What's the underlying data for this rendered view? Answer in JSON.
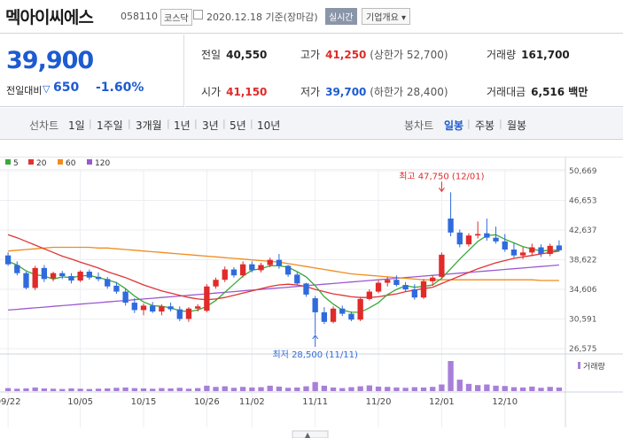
{
  "header": {
    "name": "멕아이씨에스",
    "code": "058110",
    "market": "코스닥",
    "date_text": "2020.12.18 기준(장마감)",
    "realtime_label": "실시간",
    "info_label": "기업개요 ▾"
  },
  "quote": {
    "price": "39,900",
    "change_label": "전일대비",
    "change": "650",
    "change_pct": "-1.60%"
  },
  "stats": {
    "prev_close_label": "전일",
    "prev_close": "40,550",
    "high_label": "고가",
    "high": "41,250",
    "upper_limit": "(상한가 52,700)",
    "volume_label": "거래량",
    "volume": "161,700",
    "open_label": "시가",
    "open": "41,150",
    "low_label": "저가",
    "low": "39,700",
    "lower_limit": "(하한가 28,400)",
    "amount_label": "거래대금",
    "amount": "6,516 백만"
  },
  "tabs": {
    "line_chart": "선차트",
    "t1d": "1일",
    "t1w": "1주일",
    "t3m": "3개월",
    "t1y": "1년",
    "t3y": "3년",
    "t5y": "5년",
    "t10y": "10년",
    "candle_chart": "봉차트",
    "daily": "일봉",
    "weekly": "주봉",
    "monthly": "월봉"
  },
  "colors": {
    "up": "#e12a2a",
    "down": "#2f6bdc",
    "ma5": "#3aa83a",
    "ma20": "#e03434",
    "ma60": "#f08c1e",
    "ma120": "#9b59d0",
    "volume": "#a87fd8"
  },
  "chart_data": {
    "type": "candlestick",
    "legend": [
      {
        "name": "5",
        "color": "#3aa83a"
      },
      {
        "name": "20",
        "color": "#e03434"
      },
      {
        "name": "60",
        "color": "#f08c1e"
      },
      {
        "name": "120",
        "color": "#9b59d0"
      }
    ],
    "y_ticks": [
      "50,669",
      "46,653",
      "42,637",
      "38,622",
      "34,606",
      "30,591",
      "26,575"
    ],
    "ylim": [
      26575,
      50669
    ],
    "x_ticks": [
      "09/22",
      "10/05",
      "10/15",
      "10/26",
      "11/02",
      "11/11",
      "11/20",
      "12/01",
      "12/10"
    ],
    "x_tick_index": [
      0,
      8,
      15,
      22,
      27,
      34,
      41,
      48,
      55
    ],
    "volume_label": "거래량",
    "annotations": {
      "high_text": "최고 47,750 (12/01)",
      "high_index": 48,
      "high_value": 47750,
      "low_text": "최저 28,500 (11/11)",
      "low_index": 34,
      "low_value": 28500
    },
    "candles": [
      [
        39200,
        39600,
        37800,
        38000
      ],
      [
        37900,
        38400,
        36500,
        36800
      ],
      [
        36800,
        37000,
        34600,
        34800
      ],
      [
        34800,
        37800,
        34500,
        37500
      ],
      [
        37500,
        37900,
        35600,
        36000
      ],
      [
        36100,
        37000,
        35700,
        36800
      ],
      [
        36800,
        37100,
        36000,
        36400
      ],
      [
        36400,
        36800,
        35400,
        35800
      ],
      [
        35800,
        37200,
        35600,
        37000
      ],
      [
        37000,
        37300,
        35900,
        36200
      ],
      [
        36300,
        36900,
        35700,
        36000
      ],
      [
        36000,
        36300,
        34700,
        35000
      ],
      [
        35100,
        35600,
        34000,
        34300
      ],
      [
        34300,
        34700,
        32400,
        32800
      ],
      [
        32800,
        33400,
        31400,
        31800
      ],
      [
        31800,
        32700,
        31100,
        32400
      ],
      [
        32400,
        32900,
        31400,
        31600
      ],
      [
        31600,
        32600,
        31100,
        32300
      ],
      [
        32300,
        32800,
        31600,
        31900
      ],
      [
        31900,
        32300,
        30300,
        30600
      ],
      [
        30600,
        32200,
        30200,
        32000
      ],
      [
        32000,
        32600,
        31600,
        32300
      ],
      [
        31700,
        35300,
        31500,
        35000
      ],
      [
        35000,
        36200,
        34700,
        35900
      ],
      [
        35900,
        37700,
        35600,
        37300
      ],
      [
        37300,
        37600,
        36200,
        36500
      ],
      [
        36500,
        38400,
        36200,
        38000
      ],
      [
        38000,
        38400,
        36900,
        37200
      ],
      [
        37200,
        38200,
        36900,
        37900
      ],
      [
        37900,
        38900,
        37600,
        38600
      ],
      [
        38600,
        39400,
        37400,
        37800
      ],
      [
        37800,
        37900,
        36300,
        36600
      ],
      [
        36600,
        36900,
        35200,
        35400
      ],
      [
        35400,
        35500,
        33600,
        33900
      ],
      [
        33400,
        33700,
        28500,
        31500
      ],
      [
        31500,
        32200,
        29900,
        30200
      ],
      [
        30200,
        32300,
        30000,
        32000
      ],
      [
        32000,
        32400,
        31000,
        31300
      ],
      [
        31300,
        31600,
        30300,
        30500
      ],
      [
        30500,
        33600,
        30300,
        33300
      ],
      [
        33300,
        34600,
        33100,
        34300
      ],
      [
        34300,
        35800,
        34100,
        35500
      ],
      [
        35500,
        36300,
        35000,
        35900
      ],
      [
        35900,
        36500,
        35000,
        35200
      ],
      [
        35200,
        35600,
        34300,
        34600
      ],
      [
        34600,
        35300,
        33200,
        33500
      ],
      [
        33500,
        36000,
        33300,
        35700
      ],
      [
        35700,
        36500,
        35100,
        36200
      ],
      [
        36300,
        39600,
        36100,
        39300
      ],
      [
        44200,
        47750,
        41800,
        42300
      ],
      [
        42300,
        42700,
        40300,
        40700
      ],
      [
        40700,
        42200,
        40400,
        41900
      ],
      [
        41900,
        43800,
        41500,
        42100
      ],
      [
        42200,
        44200,
        41200,
        41600
      ],
      [
        41600,
        43100,
        40800,
        41100
      ],
      [
        41100,
        42100,
        39700,
        40000
      ],
      [
        40000,
        40900,
        38900,
        39200
      ],
      [
        39200,
        40300,
        38700,
        39600
      ],
      [
        39600,
        40800,
        39100,
        40300
      ],
      [
        40300,
        40700,
        39000,
        39400
      ],
      [
        39400,
        40800,
        39100,
        40500
      ],
      [
        40550,
        41250,
        39700,
        39900
      ]
    ],
    "ma5": [
      38400,
      37900,
      37100,
      36600,
      36400,
      36000,
      36300,
      36200,
      36400,
      36500,
      36200,
      35900,
      35500,
      34700,
      33700,
      32900,
      32400,
      32300,
      32100,
      31700,
      31600,
      31800,
      32300,
      33100,
      34200,
      35300,
      36400,
      37200,
      37400,
      37800,
      37800,
      37600,
      37000,
      36300,
      35100,
      33600,
      32600,
      31800,
      31500,
      31500,
      32100,
      32800,
      33900,
      34600,
      35100,
      34900,
      35000,
      35200,
      36100,
      37400,
      38700,
      39900,
      41100,
      41900,
      42000,
      41400,
      40900,
      40400,
      40100,
      39800,
      39900,
      39900
    ],
    "ma20": [
      42000,
      41600,
      41100,
      40600,
      40100,
      39600,
      39100,
      38700,
      38300,
      37900,
      37500,
      37000,
      36600,
      36200,
      35700,
      35200,
      34800,
      34400,
      34100,
      33800,
      33500,
      33300,
      33200,
      33300,
      33500,
      33800,
      34100,
      34400,
      34700,
      35000,
      35200,
      35300,
      35200,
      35000,
      34600,
      34300,
      34000,
      33800,
      33600,
      33500,
      33500,
      33600,
      33800,
      34000,
      34300,
      34500,
      34700,
      34900,
      35400,
      35900,
      36400,
      36900,
      37400,
      37800,
      38200,
      38500,
      38800,
      39000,
      39200,
      39400,
      39600,
      39800
    ],
    "ma60": [
      39800,
      39900,
      40000,
      40100,
      40200,
      40300,
      40300,
      40300,
      40300,
      40300,
      40200,
      40200,
      40100,
      40000,
      39900,
      39800,
      39700,
      39600,
      39500,
      39400,
      39300,
      39200,
      39100,
      39000,
      38900,
      38800,
      38700,
      38600,
      38500,
      38400,
      38300,
      38100,
      37900,
      37700,
      37500,
      37300,
      37100,
      36900,
      36700,
      36600,
      36500,
      36400,
      36300,
      36200,
      36100,
      36000,
      35900,
      35900,
      35900,
      35900,
      35900,
      35900,
      35900,
      35900,
      35900,
      35900,
      35900,
      35900,
      35900,
      35800,
      35800,
      35800
    ],
    "ma120": [
      31800,
      31900,
      32000,
      32100,
      32200,
      32300,
      32400,
      32500,
      32600,
      32700,
      32800,
      32900,
      33000,
      33100,
      33200,
      33300,
      33400,
      33500,
      33600,
      33700,
      33800,
      33900,
      34000,
      34100,
      34200,
      34300,
      34400,
      34500,
      34600,
      34700,
      34800,
      34900,
      35000,
      35100,
      35200,
      35300,
      35400,
      35500,
      35600,
      35700,
      35800,
      35900,
      36000,
      36100,
      36200,
      36300,
      36400,
      36500,
      36600,
      36700,
      36800,
      36900,
      37000,
      37100,
      37200,
      37300,
      37400,
      37500,
      37600,
      37700,
      37800,
      37900
    ],
    "volume": [
      10,
      8,
      9,
      12,
      9,
      8,
      7,
      9,
      8,
      7,
      8,
      9,
      11,
      12,
      10,
      9,
      8,
      10,
      9,
      11,
      8,
      10,
      18,
      14,
      16,
      11,
      14,
      12,
      13,
      18,
      15,
      11,
      12,
      16,
      30,
      18,
      12,
      10,
      13,
      16,
      19,
      15,
      14,
      12,
      11,
      13,
      12,
      14,
      22,
      100,
      38,
      24,
      20,
      22,
      18,
      17,
      13,
      12,
      15,
      11,
      14,
      12
    ]
  }
}
